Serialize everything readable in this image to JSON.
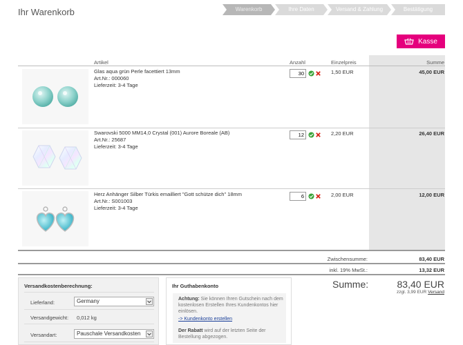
{
  "page": {
    "title": "Ihr Warenkorb"
  },
  "steps": [
    {
      "label": "Warenkorb",
      "active": true
    },
    {
      "label": "Ihre Daten",
      "active": false
    },
    {
      "label": "Versand & Zahlung",
      "active": false
    },
    {
      "label": "Bestätigung",
      "active": false
    }
  ],
  "checkout_button": {
    "label": "Kasse"
  },
  "table": {
    "headers": {
      "article": "Artikel",
      "qty": "Anzahl",
      "unit_price": "Einzelpreis",
      "sum": "Summe"
    },
    "rows": [
      {
        "name": "Glas aqua grün Perle facettiert 13mm",
        "art_nr": "Art.Nr.: 000060",
        "delivery": "Lieferzeit: 3-4 Tage",
        "qty": "30",
        "unit_price": "1,50 EUR",
        "total": "45,00 EUR"
      },
      {
        "name": "Swarovski 5000 MM14,0 Crystal (001) Aurore Boreale (AB)",
        "art_nr": "Art.Nr.: 25687",
        "delivery": "Lieferzeit: 3-4 Tage",
        "qty": "12",
        "unit_price": "2,20 EUR",
        "total": "26,40 EUR"
      },
      {
        "name": "Herz Anhänger Silber Türkis emailliert \"Gott schütze dich\" 18mm",
        "art_nr": "Art.Nr.: S001003",
        "delivery": "Lieferzeit: 3-4 Tage",
        "qty": "6",
        "unit_price": "2,00 EUR",
        "total": "12,00 EUR"
      }
    ]
  },
  "subtotals": {
    "subtotal_label": "Zwischensumme:",
    "subtotal_value": "83,40 EUR",
    "vat_label": "inkl. 19% MwSt.:",
    "vat_value": "13,32 EUR"
  },
  "shipping": {
    "title": "Versandkostenberechnung:",
    "country_label": "Lieferland:",
    "country_value": "Germany",
    "weight_label": "Versandgewicht:",
    "weight_value": "0,012 kg",
    "method_label": "Versandart:",
    "method_value": "Pauschale Versandkosten"
  },
  "credit": {
    "title": "Ihr Guthabenkonto",
    "note_prefix": "Achtung:",
    "note_text": " Sie können Ihren Gutschein nach dem kostenlosen Erstellen Ihres Kundenkontos hier einlösen.",
    "link": "-> Kundenkonto erstellen",
    "rabatt_prefix": "Der Rabatt",
    "rabatt_text": " wird auf der letzten Seite der Bestellung abgezogen."
  },
  "summary": {
    "label": "Summe:",
    "value": "83,40 EUR",
    "zzgl_text": "zzgl. 3,99 EUR ",
    "zzgl_link": "Versand"
  },
  "colors": {
    "accent": "#e5007d",
    "step_active": "#b7b7b7",
    "step_inactive": "#dadada"
  }
}
